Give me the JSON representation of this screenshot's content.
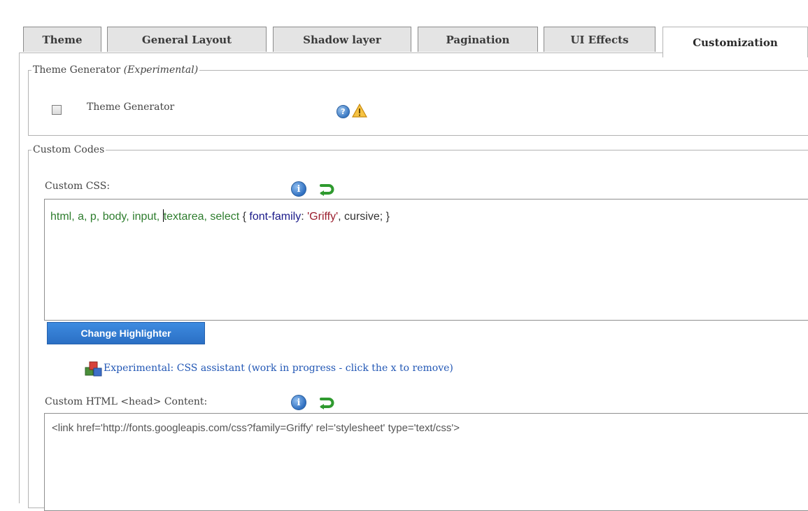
{
  "tabs": [
    {
      "label": "Theme"
    },
    {
      "label": "General Layout"
    },
    {
      "label": "Shadow layer"
    },
    {
      "label": "Pagination"
    },
    {
      "label": "UI Effects"
    },
    {
      "label": "Customization",
      "active": true
    }
  ],
  "theme_generator_section": {
    "legend": "Theme Generator",
    "legend_note": "(Experimental)",
    "checkbox_label": "Theme Generator",
    "checked": false,
    "icons": [
      "help-icon",
      "warning-icon"
    ]
  },
  "custom_codes_section": {
    "legend": "Custom Codes",
    "custom_css": {
      "label": "Custom CSS:",
      "icons": [
        "info-icon",
        "undo-icon"
      ],
      "code_tokens": {
        "t1": "html, a, p, body, input, ",
        "t2": "textarea, select",
        "t3": " { ",
        "t4": "font-family",
        "t5": ": ",
        "t6": "'Griffy'",
        "t7": ", cursive; }"
      }
    },
    "change_highlighter_label": "Change Highlighter",
    "css_assistant_link": "Experimental: CSS assistant (work in progress - click the x to remove)",
    "custom_html_head": {
      "label": "Custom HTML <head> Content:",
      "icons": [
        "info-icon",
        "undo-icon"
      ],
      "value": "<link href='http://fonts.googleapis.com/css?family=Griffy' rel='stylesheet' type='text/css'>"
    }
  },
  "colors": {
    "button_blue": "#2b6fc4",
    "link_blue": "#2257b5",
    "selector_green": "#2e7d2e",
    "string_red": "#9b1f2f"
  }
}
